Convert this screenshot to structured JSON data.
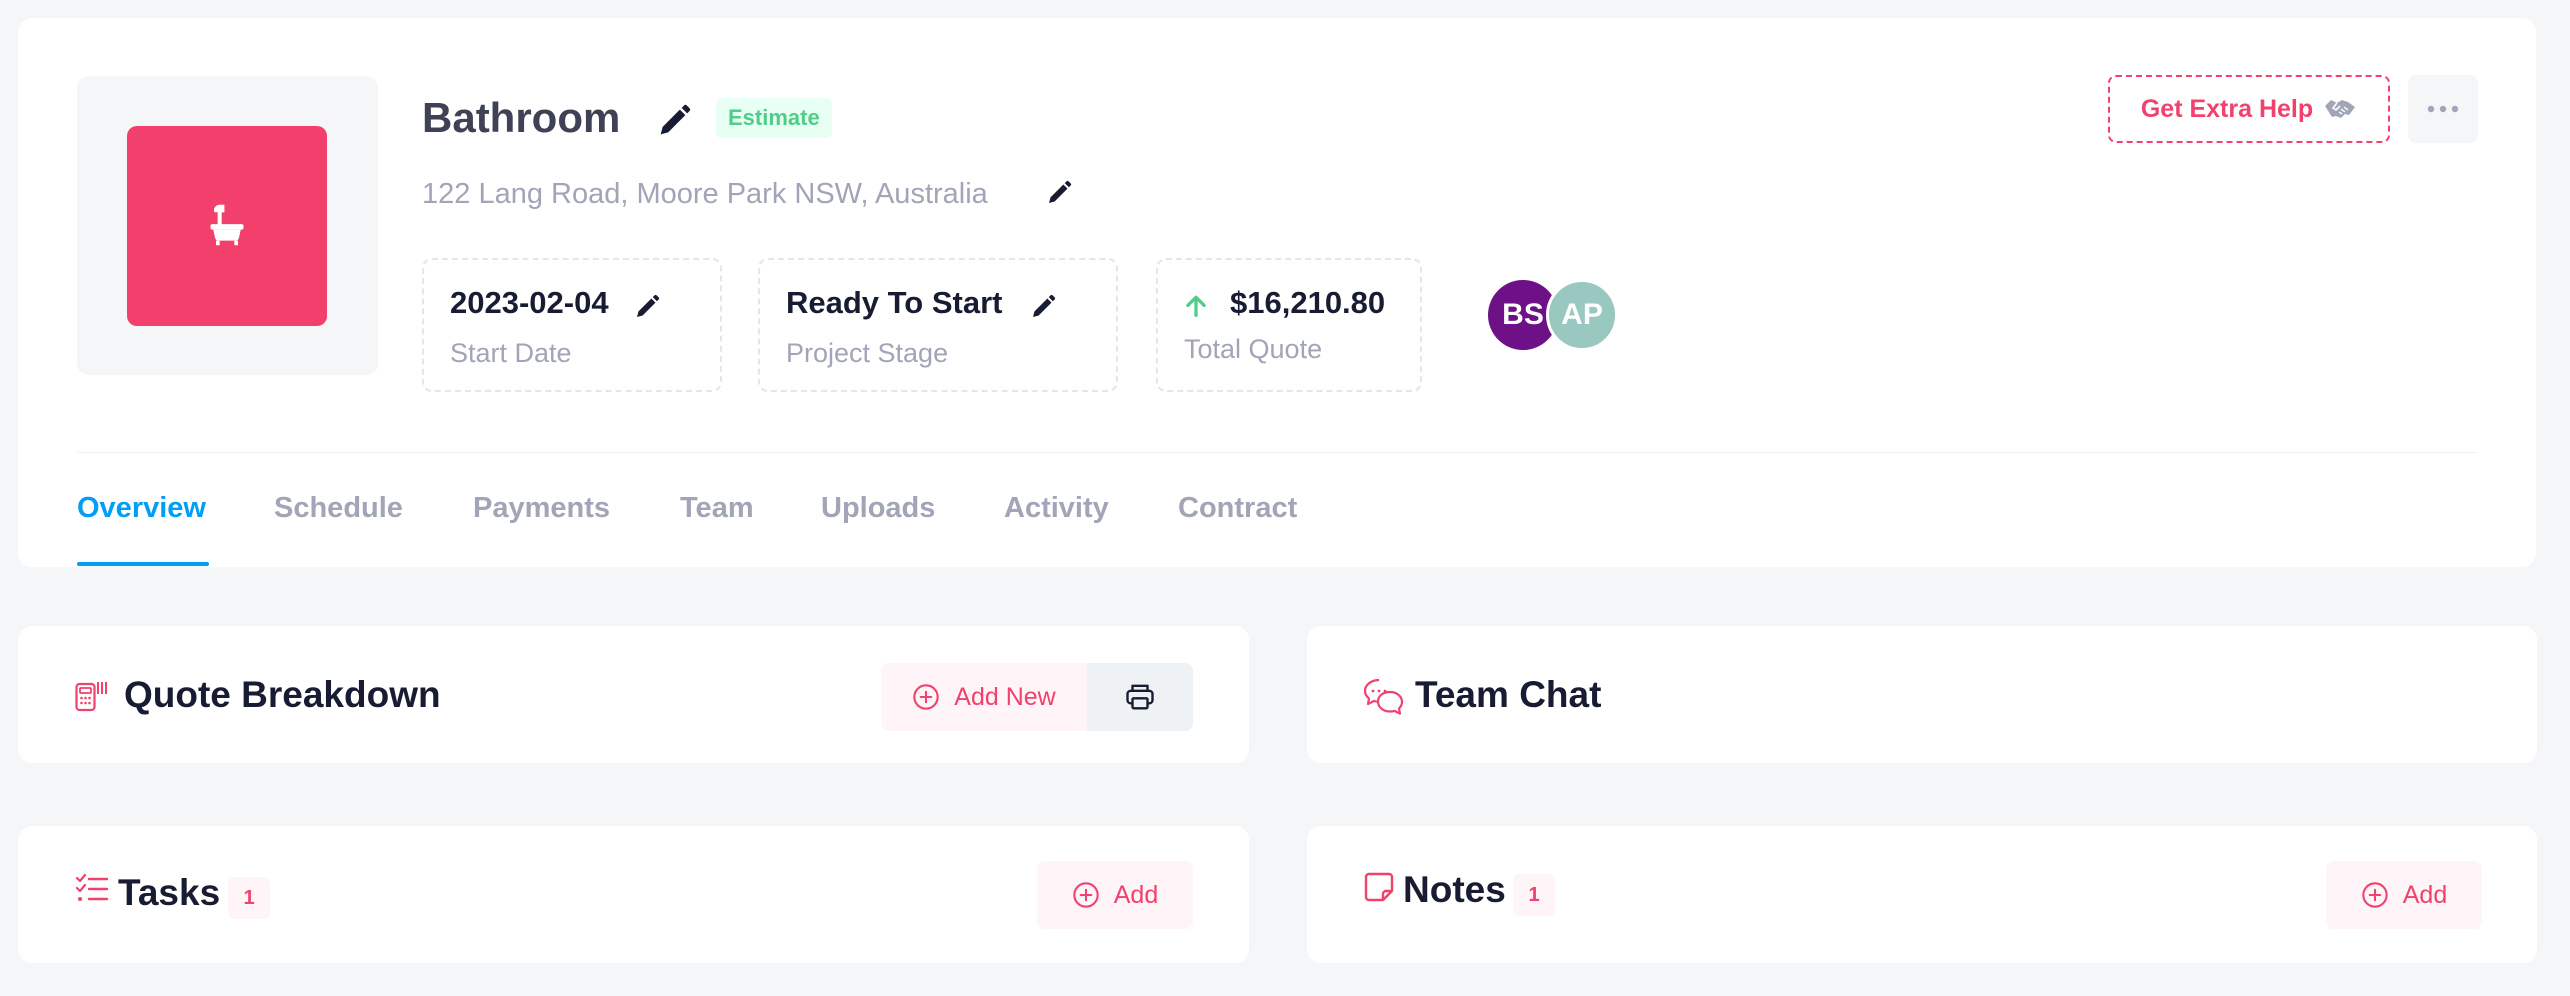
{
  "project": {
    "title": "Bathroom",
    "status_badge": "Estimate",
    "address": "122 Lang Road, Moore Park NSW, Australia",
    "thumbnail_icon": "bathtub-icon",
    "thumbnail_color": "#f33f6b"
  },
  "stats": [
    {
      "value": "2023-02-04",
      "label": "Start Date",
      "icon": "pencil-icon"
    },
    {
      "value": "Ready To Start",
      "label": "Project Stage",
      "icon": "pencil-icon"
    },
    {
      "value": "$16,210.80",
      "label": "Total Quote",
      "icon": "arrow-up-icon"
    }
  ],
  "team_avatars": [
    {
      "initials": "BS",
      "color": "#6e1186"
    },
    {
      "initials": "AP",
      "color": "#98c8c0"
    }
  ],
  "actions": {
    "extra_help_label": "Get Extra Help",
    "extra_help_icon": "handshake-icon",
    "more_icon": "more-dots-icon"
  },
  "tabs": [
    {
      "label": "Overview",
      "active": true
    },
    {
      "label": "Schedule",
      "active": false
    },
    {
      "label": "Payments",
      "active": false
    },
    {
      "label": "Team",
      "active": false
    },
    {
      "label": "Uploads",
      "active": false
    },
    {
      "label": "Activity",
      "active": false
    },
    {
      "label": "Contract",
      "active": false
    }
  ],
  "sections": {
    "quote_breakdown": {
      "title": "Quote Breakdown",
      "add_label": "Add New",
      "print_icon": "printer-icon"
    },
    "team_chat": {
      "title": "Team Chat"
    },
    "tasks": {
      "title": "Tasks",
      "count": "1",
      "add_label": "Add"
    },
    "notes": {
      "title": "Notes",
      "count": "1",
      "add_label": "Add"
    }
  },
  "colors": {
    "accent": "#f1416c",
    "primary": "#009ef7",
    "success": "#50cd89",
    "muted_text": "#a1a5b7",
    "page_bg": "#f5f6f8"
  }
}
